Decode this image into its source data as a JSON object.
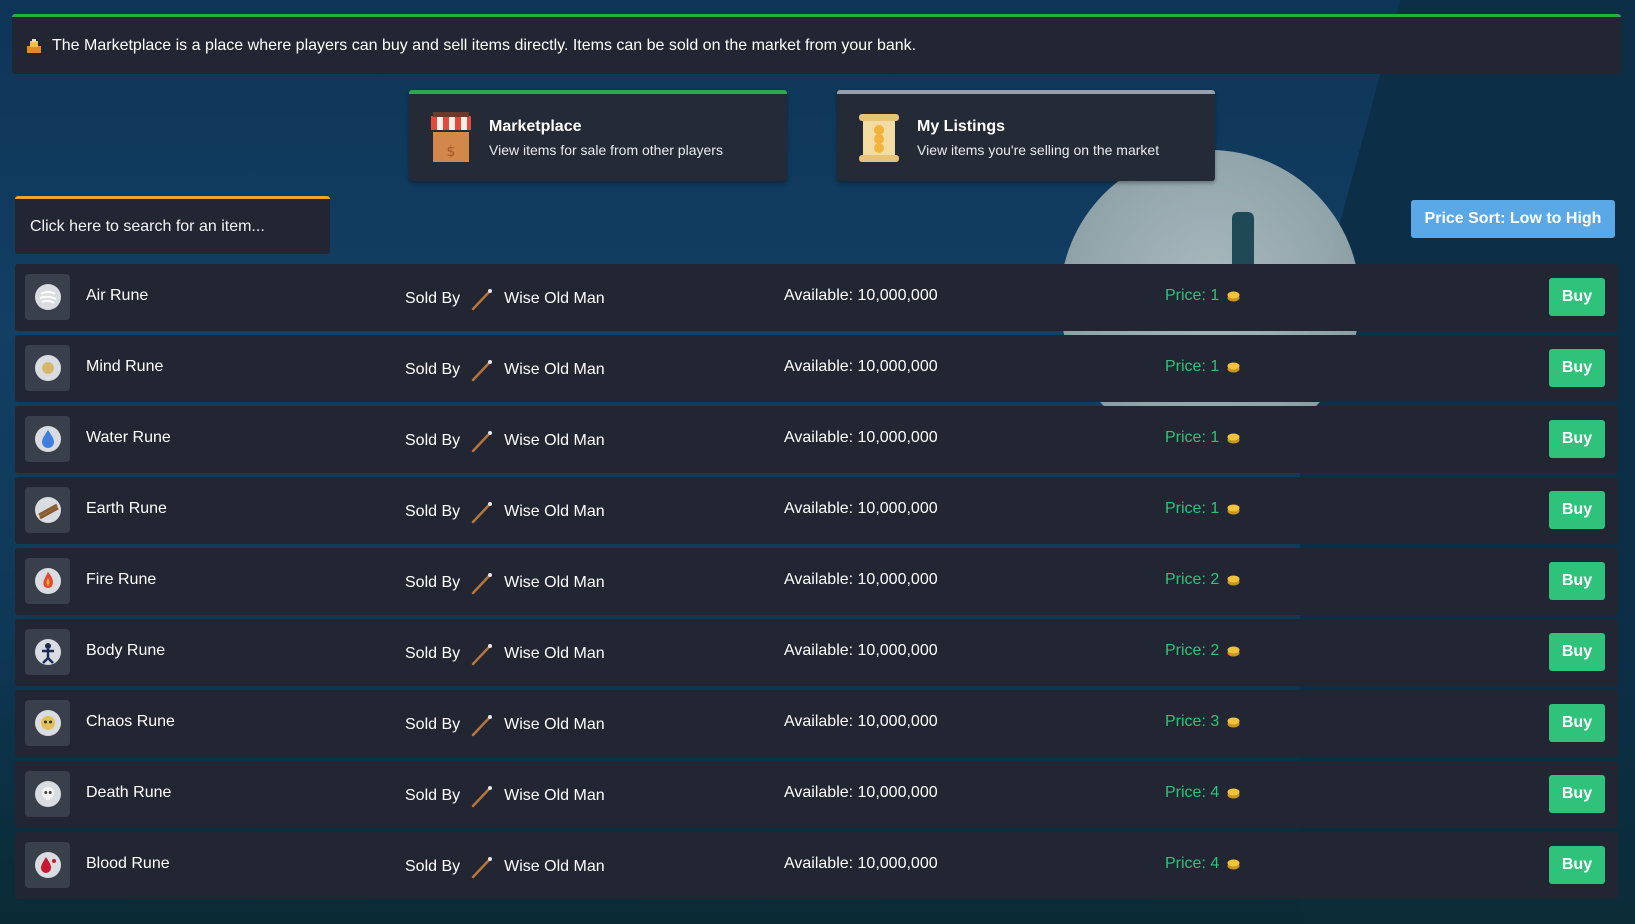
{
  "info": {
    "text": "The Marketplace is a place where players can buy and sell items directly. Items can be sold on the market from your bank."
  },
  "tabs": [
    {
      "title": "Marketplace",
      "subtitle": "View items for sale from other players"
    },
    {
      "title": "My Listings",
      "subtitle": "View items you're selling on the market"
    }
  ],
  "search": {
    "placeholder": "Click here to search for an item..."
  },
  "sort": {
    "label": "Price Sort: Low to High"
  },
  "listing": {
    "sold_by_label": "Sold By",
    "available_label": "Available:",
    "price_label": "Price:",
    "buy_label": "Buy"
  },
  "items": [
    {
      "name": "Air Rune",
      "seller": "Wise Old Man",
      "available": "10,000,000",
      "price": "1",
      "icon": "air-rune"
    },
    {
      "name": "Mind Rune",
      "seller": "Wise Old Man",
      "available": "10,000,000",
      "price": "1",
      "icon": "mind-rune"
    },
    {
      "name": "Water Rune",
      "seller": "Wise Old Man",
      "available": "10,000,000",
      "price": "1",
      "icon": "water-rune"
    },
    {
      "name": "Earth Rune",
      "seller": "Wise Old Man",
      "available": "10,000,000",
      "price": "1",
      "icon": "earth-rune"
    },
    {
      "name": "Fire Rune",
      "seller": "Wise Old Man",
      "available": "10,000,000",
      "price": "2",
      "icon": "fire-rune"
    },
    {
      "name": "Body Rune",
      "seller": "Wise Old Man",
      "available": "10,000,000",
      "price": "2",
      "icon": "body-rune"
    },
    {
      "name": "Chaos Rune",
      "seller": "Wise Old Man",
      "available": "10,000,000",
      "price": "3",
      "icon": "chaos-rune"
    },
    {
      "name": "Death Rune",
      "seller": "Wise Old Man",
      "available": "10,000,000",
      "price": "4",
      "icon": "death-rune"
    },
    {
      "name": "Blood Rune",
      "seller": "Wise Old Man",
      "available": "10,000,000",
      "price": "4",
      "icon": "blood-rune"
    }
  ],
  "colors": {
    "accent_green": "#2fa84a",
    "price_green": "#2fc27a",
    "sort_blue": "#5aa8e6",
    "search_orange": "#f0a61c",
    "panel": "#222633"
  }
}
